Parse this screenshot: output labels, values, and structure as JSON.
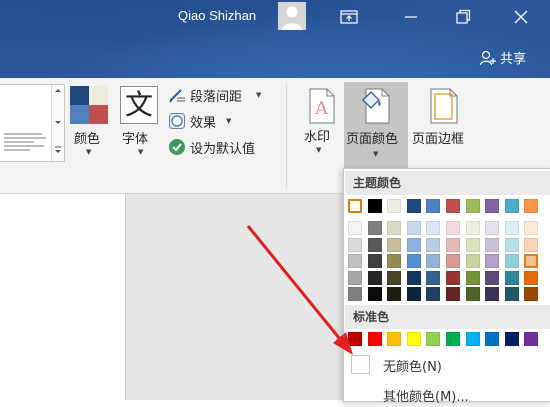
{
  "header": {
    "user_name": "Qiao Shizhan",
    "share_label": "共享"
  },
  "ribbon": {
    "colors_label": "颜色",
    "fonts_label": "字体",
    "paragraph_spacing_label": "段落间距",
    "effects_label": "效果",
    "set_default_label": "设为默认值",
    "watermark_label": "水印",
    "page_color_label": "页面颜色",
    "page_borders_label": "页面边框"
  },
  "color_menu": {
    "theme_colors_title": "主题颜色",
    "standard_colors_title": "标准色",
    "no_color_label": "无颜色(N)",
    "more_colors_label": "其他颜色(M)...",
    "theme_columns": [
      [
        "#ffffff",
        "#f2f2f2",
        "#d9d9d9",
        "#bfbfbf",
        "#a6a6a6",
        "#808080"
      ],
      [
        "#000000",
        "#808080",
        "#595959",
        "#404040",
        "#262626",
        "#0d0d0d"
      ],
      [
        "#eeece1",
        "#ddd9c4",
        "#c4bd97",
        "#948a54",
        "#4a452a",
        "#1e1c11"
      ],
      [
        "#1f497d",
        "#c6d9f0",
        "#8db3e2",
        "#548dd4",
        "#17365d",
        "#0f243e"
      ],
      [
        "#4f81bd",
        "#dbe5f1",
        "#b8cce4",
        "#95b3d7",
        "#366092",
        "#244061"
      ],
      [
        "#c0504d",
        "#f2dcdb",
        "#e6b8b7",
        "#da9694",
        "#963634",
        "#632523"
      ],
      [
        "#9bbb59",
        "#ebf1de",
        "#d7e4bc",
        "#c3d69b",
        "#76923c",
        "#4f6228"
      ],
      [
        "#8064a2",
        "#e5e0ec",
        "#ccc1d9",
        "#b2a1c7",
        "#5f497a",
        "#3f3151"
      ],
      [
        "#4bacc6",
        "#dbeef3",
        "#b7dde8",
        "#92cddc",
        "#31859b",
        "#215967"
      ],
      [
        "#f79646",
        "#fde9d9",
        "#fbd4b4",
        "#fac08f",
        "#e36c09",
        "#974806"
      ]
    ],
    "standard_colors": [
      "#c00000",
      "#ff0000",
      "#ffc000",
      "#ffff00",
      "#92d050",
      "#00b050",
      "#00b0f0",
      "#0070c0",
      "#002060",
      "#7030a0"
    ],
    "selected_theme_swatch": [
      0,
      0
    ],
    "highlighted_theme_swatch": [
      9,
      3
    ]
  }
}
